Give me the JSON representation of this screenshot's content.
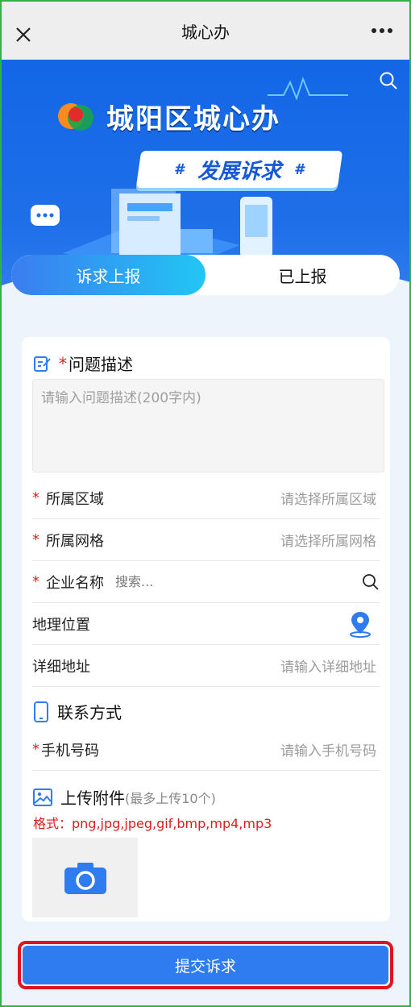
{
  "topbar": {
    "title": "城心办"
  },
  "banner": {
    "brand_text": "城阳区城心办",
    "pill_text": "发展诉求",
    "pill_hash": "#"
  },
  "tabs": [
    {
      "label": "诉求上报",
      "active": true
    },
    {
      "label": "已上报",
      "active": false
    }
  ],
  "form": {
    "description": {
      "required_mark": "*",
      "label": "问题描述",
      "placeholder": "请输入问题描述(200字内)"
    },
    "district": {
      "required_mark": "*",
      "label": "所属区域",
      "placeholder": "请选择所属区域"
    },
    "grid": {
      "required_mark": "*",
      "label": "所属网格",
      "placeholder": "请选择所属网格"
    },
    "company": {
      "required_mark": "*",
      "label": "企业名称",
      "placeholder": "搜索..."
    },
    "location": {
      "label": "地理位置"
    },
    "address": {
      "label": "详细地址",
      "placeholder": "请输入详细地址"
    },
    "contact": {
      "label": "联系方式"
    },
    "phone": {
      "required_mark": "*",
      "label": "手机号码",
      "placeholder": "请输入手机号码"
    },
    "attachments": {
      "label": "上传附件",
      "hint": "(最多上传10个)",
      "formats": "格式：png,jpg,jpeg,gif,bmp,mp4,mp3"
    }
  },
  "submit_label": "提交诉求",
  "colors": {
    "primary": "#2e7cf0",
    "required": "#e02020",
    "highlight_border": "#e0141e"
  }
}
